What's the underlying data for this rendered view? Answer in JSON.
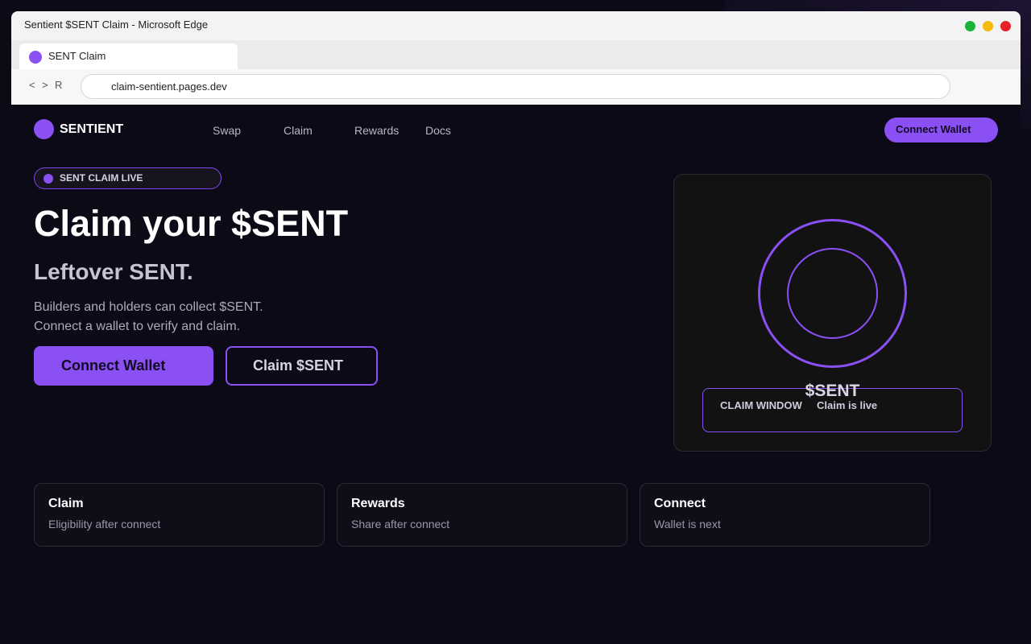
{
  "browser": {
    "window_title": "Sentient $SENT Claim - Microsoft Edge",
    "tab_label": "SENT Claim",
    "nav_back": "<",
    "nav_forward": ">",
    "nav_reload": "R",
    "url": "claim-sentient.pages.dev",
    "colors": {
      "close": "#e5202b",
      "minimize": "#f8b90d",
      "maximize": "#1bb33a"
    }
  },
  "header": {
    "logo_text": "SENTIENT",
    "nav": [
      "Swap",
      "Claim",
      "Rewards",
      "Docs"
    ],
    "cta_label": "Connect Wallet"
  },
  "hero": {
    "badge": "SENT CLAIM LIVE",
    "title": "Claim your $SENT",
    "subtitle": "Leftover SENT.",
    "desc_line1": "Builders and holders can collect $SENT.",
    "desc_line2": "Connect a wallet to verify and claim.",
    "primary_button": "Connect Wallet",
    "secondary_button": "Claim $SENT"
  },
  "token_card": {
    "token": "$SENT",
    "window_label": "CLAIM WINDOW",
    "window_status": "Claim is live"
  },
  "features": [
    {
      "title": "Claim",
      "desc": "Eligibility after connect"
    },
    {
      "title": "Rewards",
      "desc": "Share after connect"
    },
    {
      "title": "Connect",
      "desc": "Wallet is next"
    }
  ],
  "theme": {
    "accent": "#8b50f4",
    "background": "#0c0a16"
  }
}
